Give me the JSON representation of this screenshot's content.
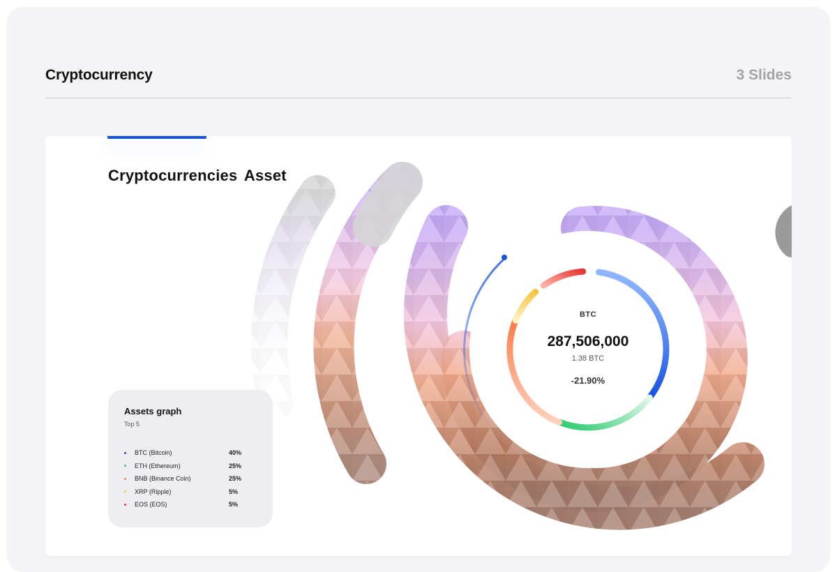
{
  "header": {
    "title": "Cryptocurrency",
    "slide_count": "3 Slides"
  },
  "slide": {
    "title": "Cryptocurrencies  Asset",
    "center": {
      "symbol": "BTC",
      "value": "287,506,000",
      "sub_value": "1.38 BTC",
      "change": "-21.90%"
    },
    "assets_card": {
      "title": "Assets graph",
      "subtitle": "Top 5",
      "items": [
        {
          "name": "BTC (Bitcoin)",
          "pct": "40%",
          "color": "#1652e0"
        },
        {
          "name": "ETH (Ethereum)",
          "pct": "25%",
          "color": "#2ecc71"
        },
        {
          "name": "BNB (Binance Coin)",
          "pct": "25%",
          "color": "#ff7a45"
        },
        {
          "name": "XRP (Ripple)",
          "pct": "5%",
          "color": "#f5c542"
        },
        {
          "name": "EOS (EOS)",
          "pct": "5%",
          "color": "#e53935"
        }
      ]
    }
  },
  "colors": {
    "accent": "#1652e0",
    "panel_bg": "#f4f4f6"
  }
}
